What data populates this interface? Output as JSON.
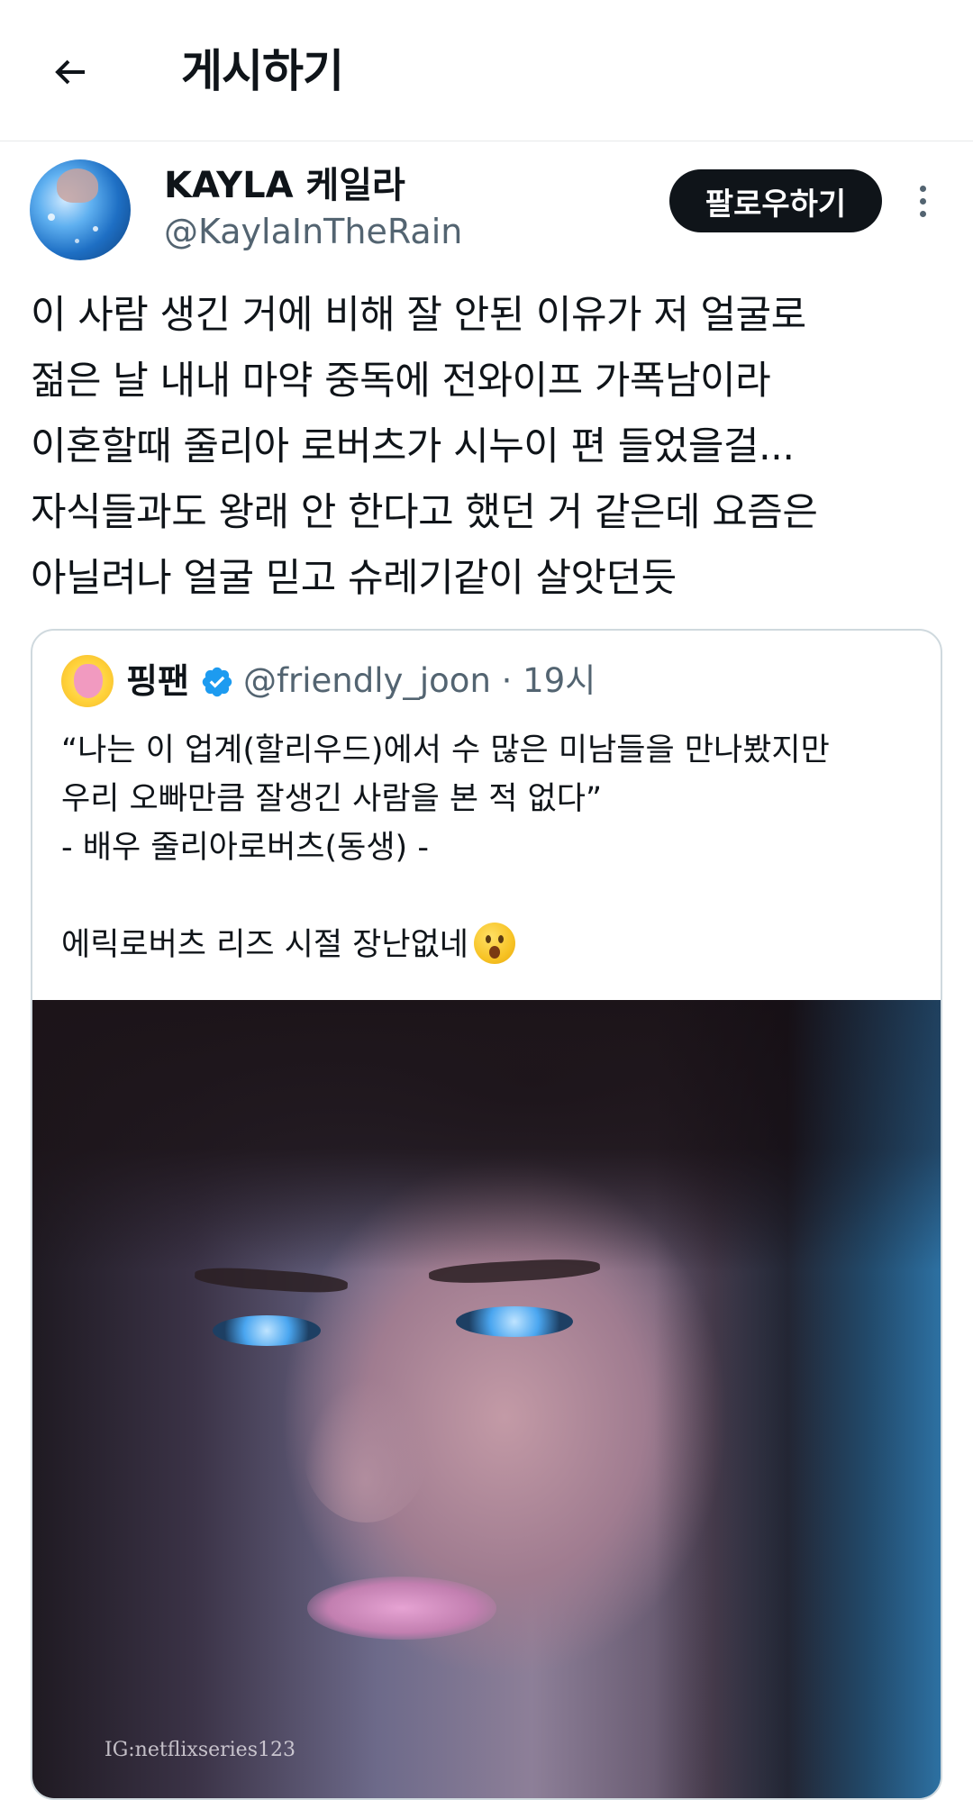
{
  "header": {
    "title": "게시하기",
    "back_icon": "arrow-left-icon"
  },
  "post": {
    "display_name": "KAYLA 케일라",
    "handle": "@KaylaInTheRain",
    "follow_label": "팔로우하기",
    "more_icon": "more-vertical-icon",
    "body": "이 사람 생긴 거에 비해 잘 안된 이유가 저 얼굴로\n젊은 날 내내 마약 중독에 전와이프 가폭남이라\n이혼할때 줄리아 로버츠가 시누이 편 들었을걸...\n자식들과도 왕래 안 한다고 했던 거 같은데 요즘은\n아닐려나 얼굴 믿고 슈레기같이 살앗던듯"
  },
  "quote": {
    "display_name": "핑팬",
    "verified_icon": "verified-badge-icon",
    "handle_time": "@friendly_joon · 19시",
    "text": "“나는 이 업계(할리우드)에서 수 많은 미남들을 만나봤지만\n우리 오빠만큼 잘생긴 사람을 본 적 없다”\n- 배우 줄리아로버츠(동생) -\n\n에릭로버츠 리즈 시절 장난없네",
    "emoji": "surprised-face-emoji",
    "media_watermark": "IG:netflixseries123"
  },
  "colors": {
    "text": "#0f1419",
    "secondary": "#536471",
    "follow_bg": "#0f1419",
    "verified": "#1d9bf0",
    "border": "#cfd9de"
  }
}
